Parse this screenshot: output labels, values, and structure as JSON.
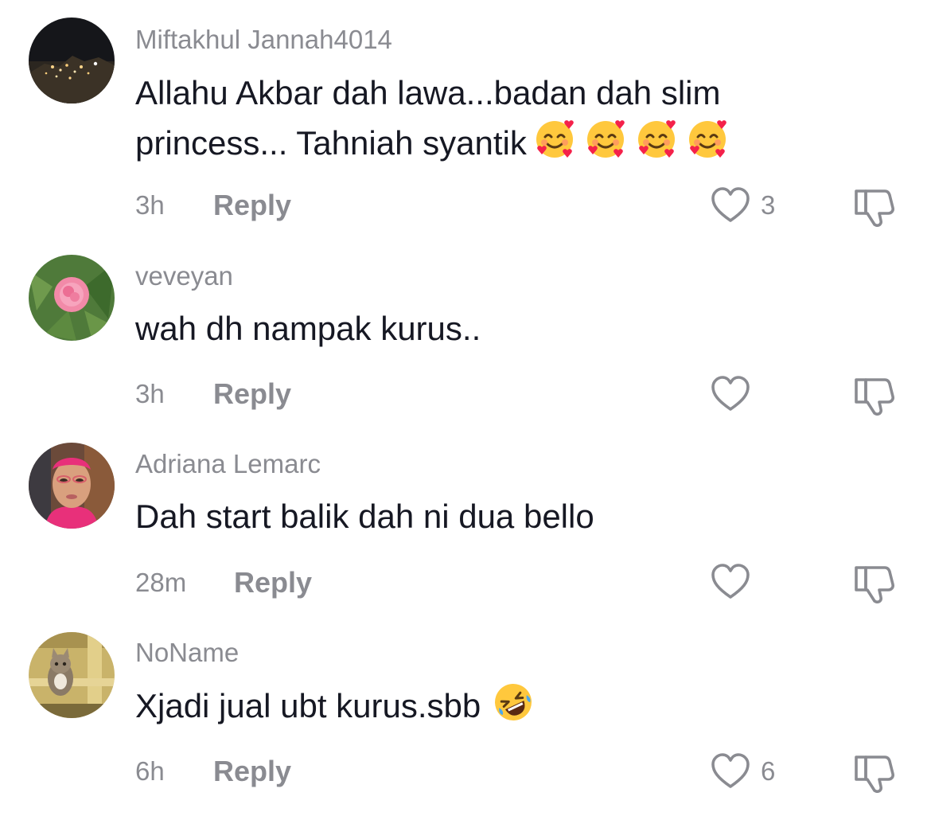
{
  "comments": [
    {
      "username": "Miftakhul Jannah4014",
      "text": "Allahu Akbar dah lawa...badan dah slim princess... Tahniah syantik",
      "emojis": [
        "smiling-face-with-hearts-emoji",
        "smiling-face-with-hearts-emoji",
        "smiling-face-with-hearts-emoji",
        "smiling-face-with-hearts-emoji"
      ],
      "time": "3h",
      "reply_label": "Reply",
      "likes": "3"
    },
    {
      "username": "veveyan",
      "text": "wah dh nampak kurus..",
      "emojis": [],
      "time": "3h",
      "reply_label": "Reply",
      "likes": ""
    },
    {
      "username": "Adriana Lemarc",
      "text": "Dah start balik dah ni dua bello",
      "emojis": [],
      "time": "28m",
      "reply_label": "Reply",
      "likes": ""
    },
    {
      "username": "NoName",
      "text": "Xjadi jual ubt kurus.sbb",
      "emojis": [
        "rolling-on-floor-laughing-emoji"
      ],
      "time": "6h",
      "reply_label": "Reply",
      "likes": "6"
    }
  ],
  "icons": {
    "like": "heart-outline-icon",
    "dislike": "thumbs-down-icon"
  },
  "colors": {
    "text": "#161823",
    "secondary": "#8a8b91",
    "background": "#ffffff"
  }
}
